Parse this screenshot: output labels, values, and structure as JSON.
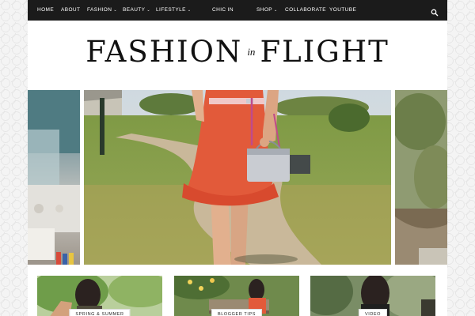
{
  "nav": {
    "items": [
      {
        "label": "HOME",
        "chevron": false
      },
      {
        "label": "ABOUT",
        "chevron": false
      },
      {
        "label": "FASHION",
        "chevron": true
      },
      {
        "label": "BEAUTY",
        "chevron": true
      },
      {
        "label": "LIFESTYLE",
        "chevron": true
      },
      {
        "label": "CHIC IN",
        "chevron": false
      },
      {
        "label": "SHOP",
        "chevron": true
      },
      {
        "label": "COLLABORATE",
        "chevron": false
      },
      {
        "label": "YOUTUBE",
        "chevron": false
      }
    ],
    "chevron_glyph": "⌄",
    "search_icon": "search-icon"
  },
  "logo": {
    "word1": "FASHION",
    "word2": "in",
    "word3": "FLIGHT"
  },
  "cards": [
    {
      "label": "SPRING & SUMMER"
    },
    {
      "label": "BLOGGER TIPS"
    },
    {
      "label": "VIDEO"
    }
  ],
  "colors": {
    "nav_bg": "#1b1b1b",
    "dress": "#e25a3a",
    "bag": "#c9ccd2"
  }
}
